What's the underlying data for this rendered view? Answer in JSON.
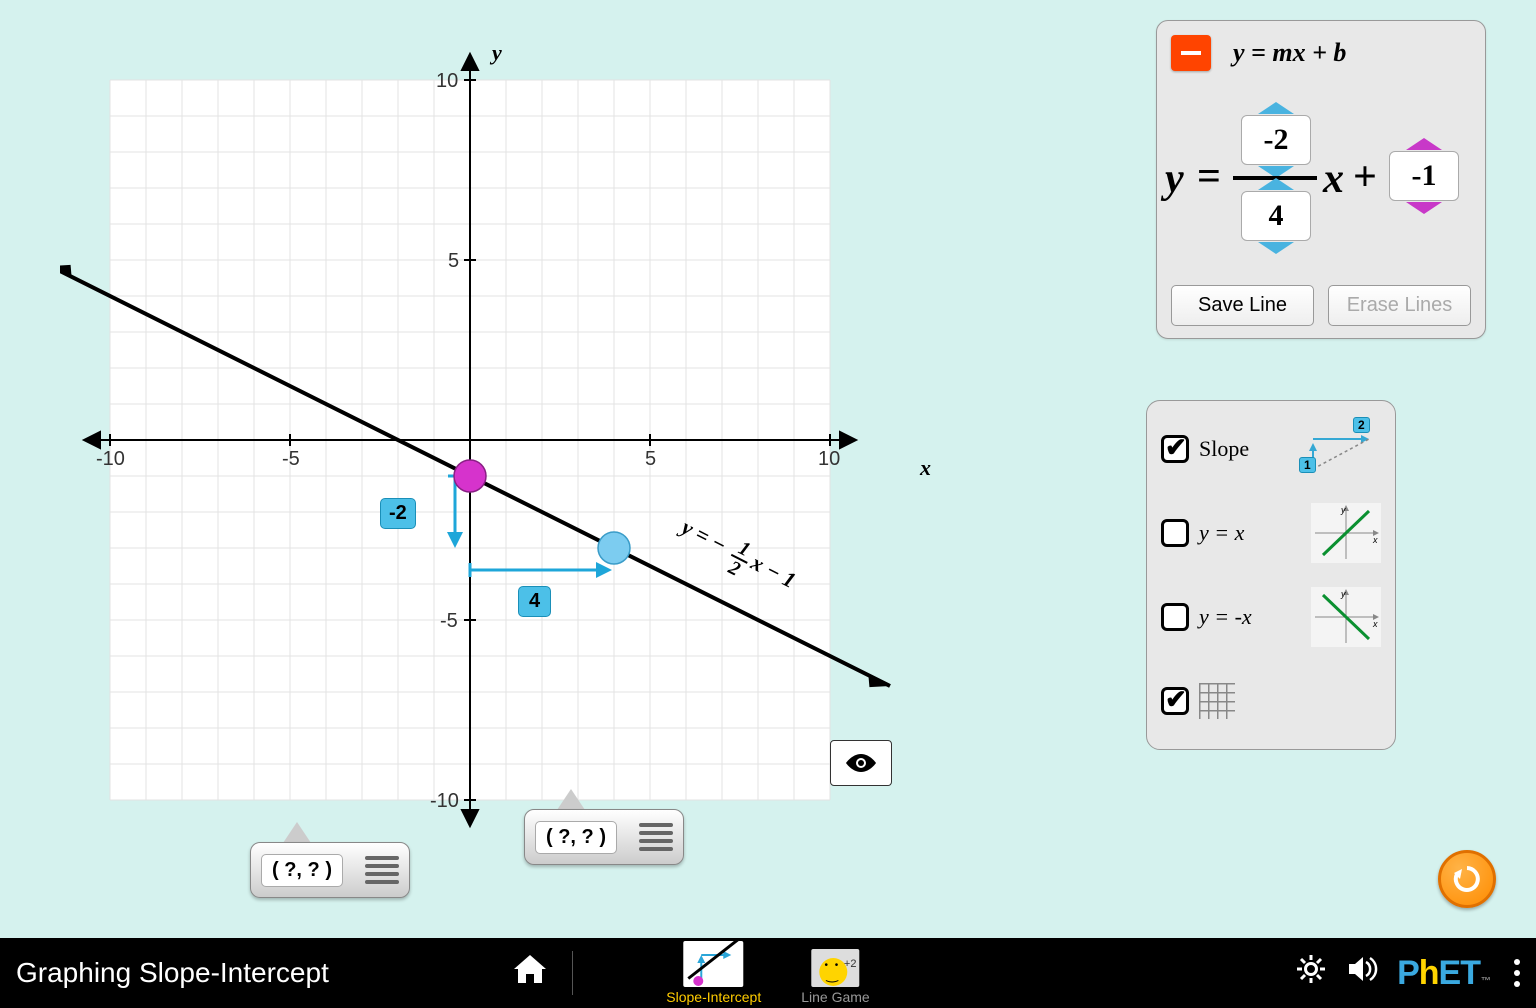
{
  "chart_data": {
    "type": "line",
    "title": "",
    "xlabel": "x",
    "ylabel": "y",
    "xlim": [
      -10,
      10
    ],
    "ylim": [
      -10,
      10
    ],
    "x_ticks": [
      -10,
      -5,
      5,
      10
    ],
    "y_ticks": [
      -10,
      -5,
      5,
      10
    ],
    "series": [
      {
        "name": "y = -1/2 x - 1",
        "slope": -0.5,
        "intercept": -1
      }
    ],
    "points": {
      "intercept_point": [
        0,
        -1
      ],
      "slope_point": [
        4,
        -3
      ]
    },
    "rise_run": {
      "rise": -2,
      "run": 4
    },
    "line_label": "y = -½ x - 1"
  },
  "axis": {
    "y": "y",
    "x": "x",
    "neg10": "-10",
    "neg5": "-5",
    "pos5": "5",
    "pos10": "10"
  },
  "graph": {
    "rise_label": "-2",
    "run_label": "4",
    "line_label_y": "y",
    "line_label_eq": " = ",
    "line_label_minus": "−",
    "line_label_num": "1",
    "line_label_den": "2",
    "line_label_x": "x",
    "line_label_minus2": " − ",
    "line_label_b": "1"
  },
  "equation": {
    "header": "y = mx + b",
    "y": "y",
    "eq": " = ",
    "x": "x",
    "plus": " + ",
    "rise": "-2",
    "run": "4",
    "intercept": "-1",
    "save": "Save Line",
    "erase": "Erase Lines"
  },
  "options": {
    "slope": "Slope",
    "slope_icon_1": "1",
    "slope_icon_2": "2",
    "yx": "y = x",
    "ynegx": "y = -x"
  },
  "point_tool": {
    "coord": "( ?, ? )"
  },
  "nav": {
    "title": "Graphing Slope-Intercept",
    "screen1": "Slope-Intercept",
    "screen2": "Line Game",
    "plus2": "+2"
  }
}
